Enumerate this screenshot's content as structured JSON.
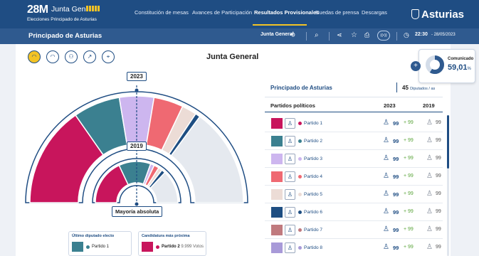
{
  "header": {
    "brand_big": "28M",
    "brand_title": "Junta General",
    "brand_sub": "Elecciones Principado de Asturias",
    "nav": [
      {
        "label": "Constitución de mesas",
        "active": false
      },
      {
        "label": "Avances de Participación",
        "active": false
      },
      {
        "label": "Resultados Provisionales",
        "active": true
      },
      {
        "label": "Ruedas de prensa",
        "active": false
      },
      {
        "label": "Descargas",
        "active": false
      }
    ],
    "logo_text": "Asturias"
  },
  "subbar": {
    "region": "Principado de Asturias",
    "chamber_select": "Junta General",
    "live_label": "((•))",
    "time": "22:30",
    "date": "- 28/05/2023"
  },
  "main": {
    "title": "Junta General",
    "chart_icons": [
      "hemicycle-icon",
      "hemicycle-compare-icon",
      "people-icon",
      "trend-icon",
      "map-pin-icon"
    ]
  },
  "comunicado": {
    "label": "Comunicado",
    "value": "59,01",
    "unit": "%",
    "fraction": 0.5901
  },
  "hemicycle": {
    "year_current": "2023",
    "year_previous": "2019",
    "majority_label": "Mayoría absoluta"
  },
  "last_elected": {
    "title": "Último diputado electo",
    "party": "Partido 1",
    "color": "#c8155c"
  },
  "next_candidate": {
    "title": "Candidatura más próxima",
    "party": "Partido 2",
    "votes": "9.999 Votos",
    "color": "#c8155c"
  },
  "table": {
    "region": "Principado de Asturias",
    "seats_total": "45",
    "seats_unit": "Diputados / as",
    "col_parties": "Partidos políticos",
    "col_current": "2023",
    "col_previous": "2019",
    "rows": [
      {
        "party": "Partido 1",
        "color": "#c8155c",
        "seats": "99",
        "delta": "+ 99",
        "prev": "99"
      },
      {
        "party": "Partido 2",
        "color": "#3b8090",
        "seats": "99",
        "delta": "+ 99",
        "prev": "99"
      },
      {
        "party": "Partido 3",
        "color": "#cdb6ef",
        "seats": "99",
        "delta": "+ 99",
        "prev": "99"
      },
      {
        "party": "Partido 4",
        "color": "#ef6972",
        "seats": "99",
        "delta": "+ 99",
        "prev": "99"
      },
      {
        "party": "Partido 5",
        "color": "#ecdcd6",
        "seats": "99",
        "delta": "+ 99",
        "prev": "99"
      },
      {
        "party": "Partido 6",
        "color": "#1e4e82",
        "seats": "99",
        "delta": "+ 99",
        "prev": "99"
      },
      {
        "party": "Partido 7",
        "color": "#c07a7e",
        "seats": "99",
        "delta": "+ 99",
        "prev": "99"
      },
      {
        "party": "Partido 8",
        "color": "#a89ad8",
        "seats": "99",
        "delta": "+ 99",
        "prev": "99"
      }
    ]
  }
}
